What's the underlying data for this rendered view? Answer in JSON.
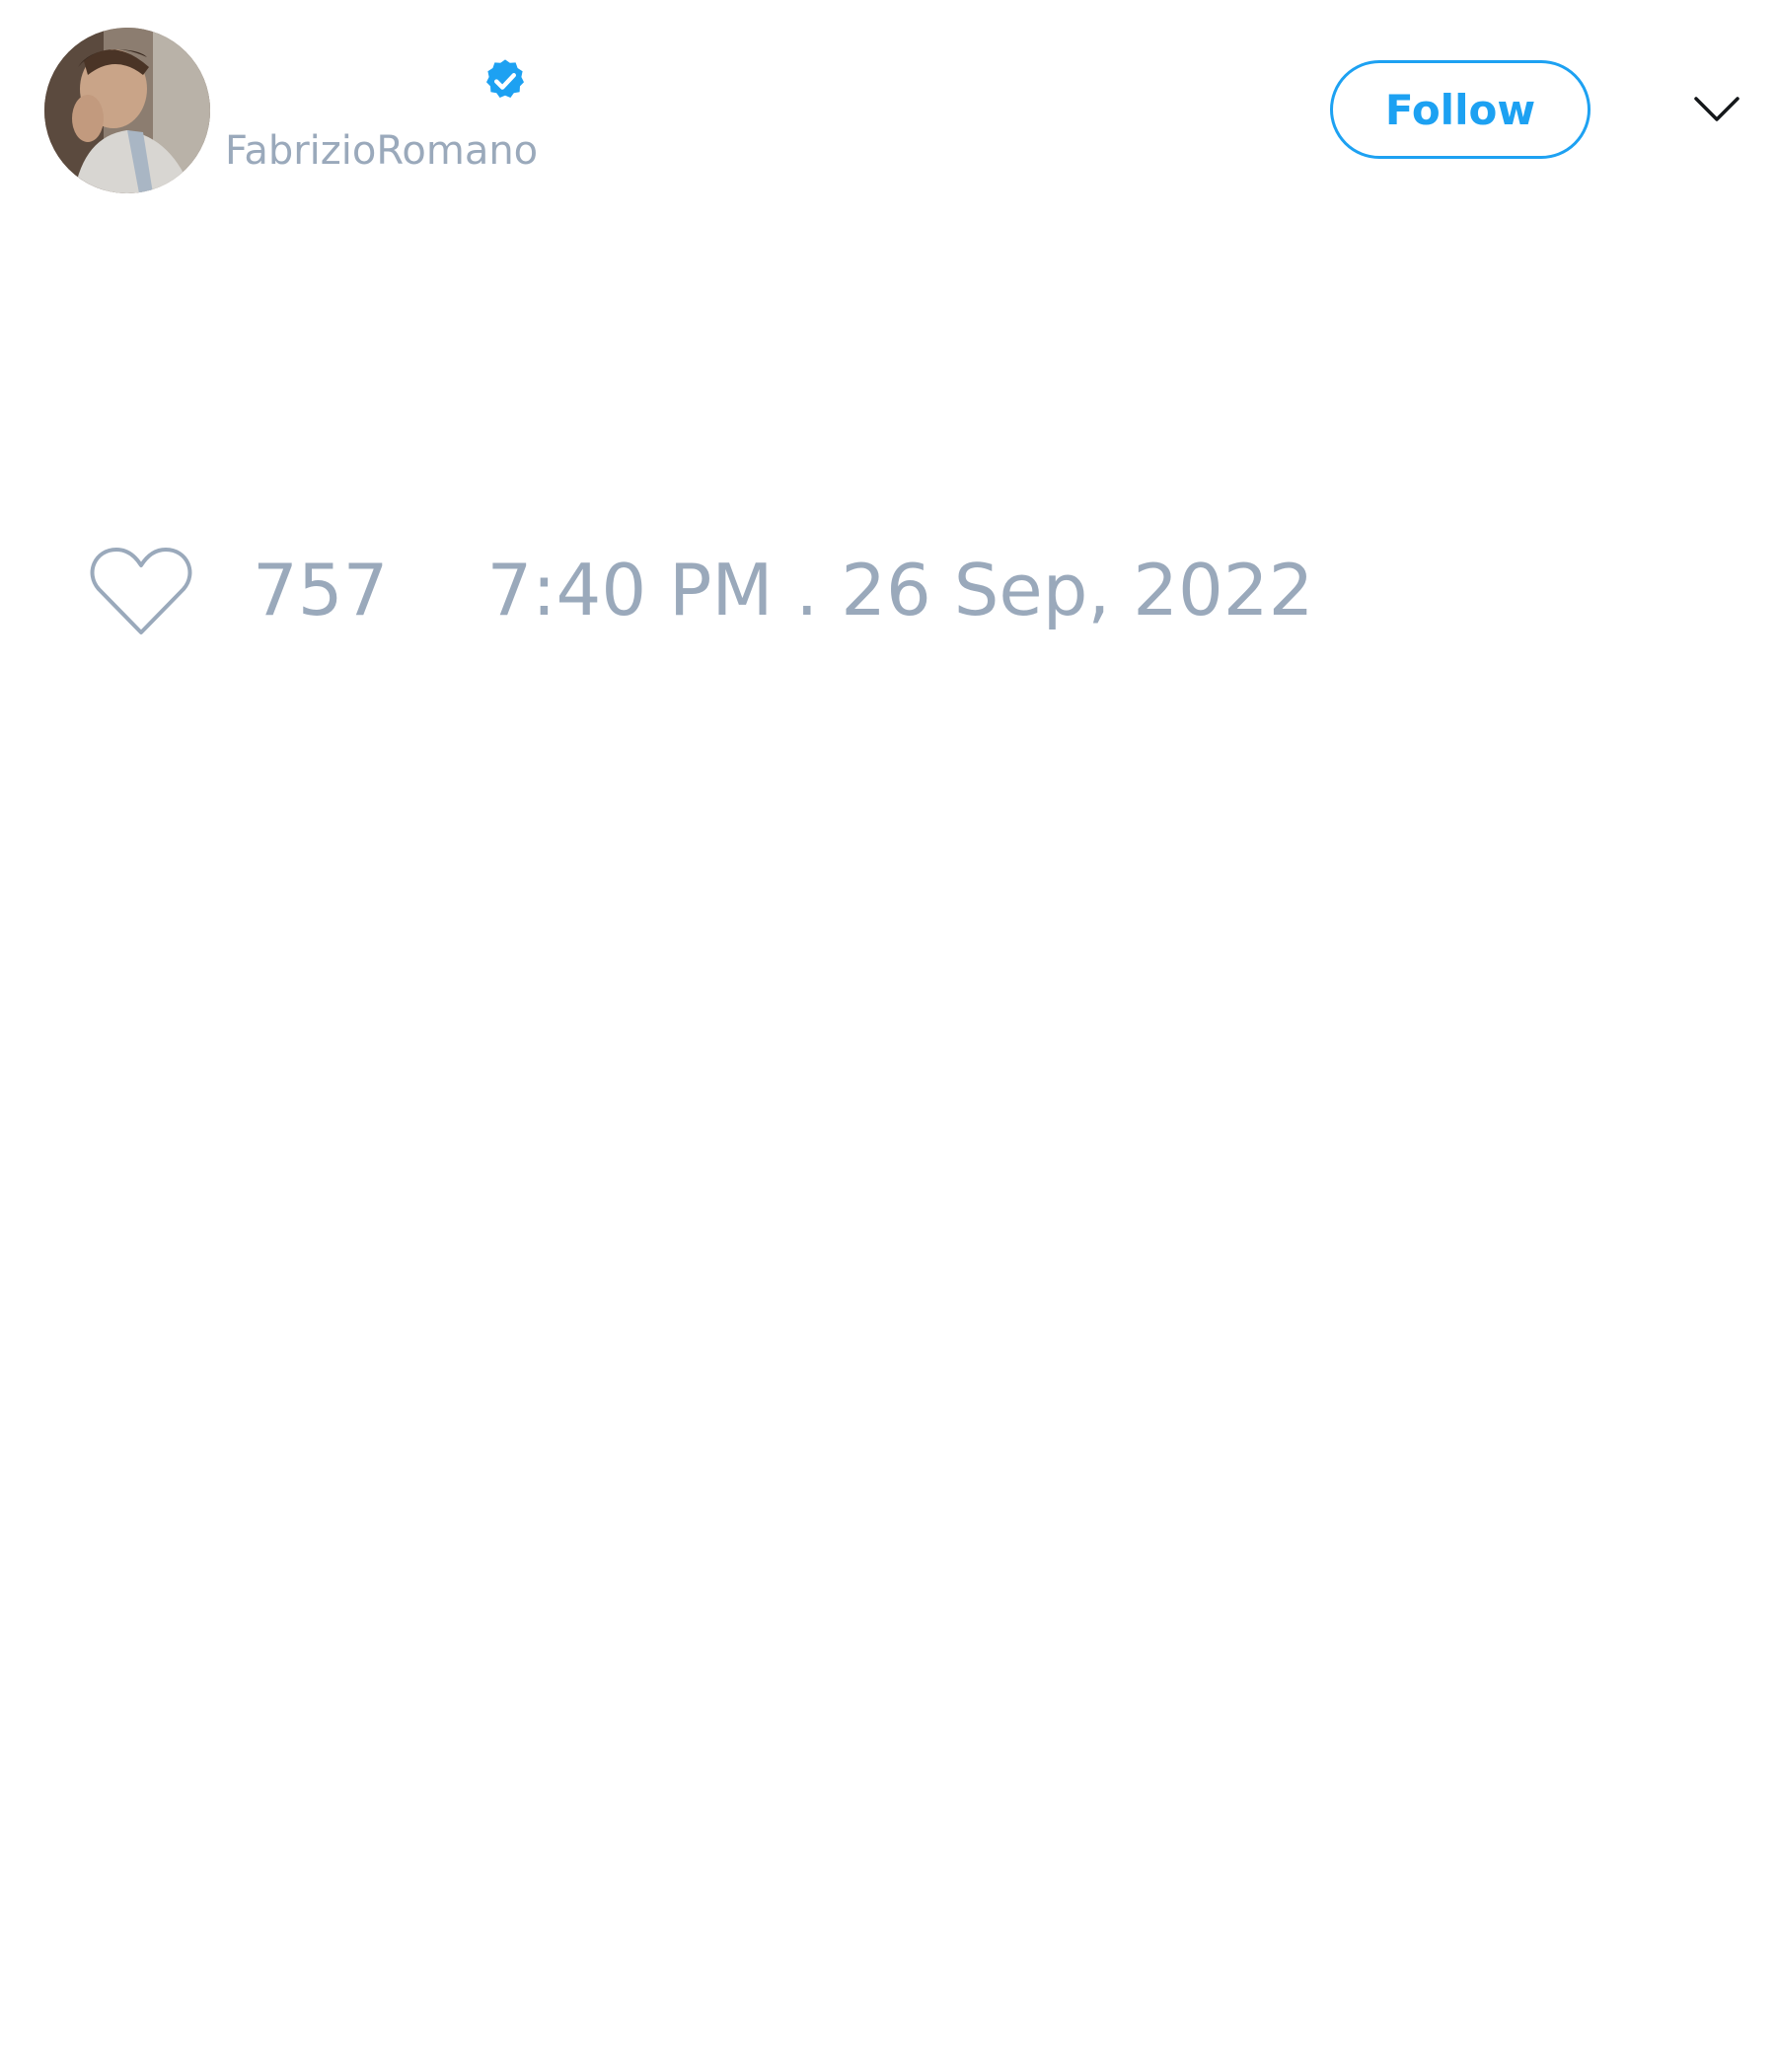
{
  "tweet": {
    "author": {
      "handle": "FabrizioRomano",
      "verified": true,
      "avatar": "profile-photo"
    },
    "follow_label": "Follow",
    "likes": "757",
    "timestamp": "7:40 PM . 26 Sep, 2022"
  },
  "icons": {
    "verified": "verified-badge-icon",
    "menu": "chevron-down-icon",
    "like": "heart-icon"
  },
  "colors": {
    "accent": "#1da1f2",
    "muted_text": "#9aa9bb",
    "background": "#ffffff"
  }
}
